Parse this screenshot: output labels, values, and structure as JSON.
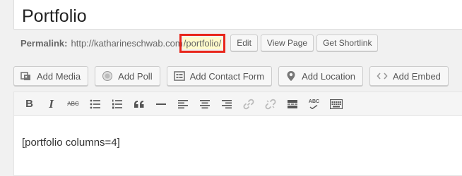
{
  "post": {
    "title": "Portfolio"
  },
  "permalink": {
    "label": "Permalink:",
    "host": "http://katharineschwab.com",
    "slash_before": "/",
    "slug": "portfolio",
    "slash_after": "/",
    "edit_label": "Edit",
    "view_label": "View Page",
    "shortlink_label": "Get Shortlink"
  },
  "media_buttons": {
    "add_media": "Add Media",
    "add_poll": "Add Poll",
    "add_contact_form": "Add Contact Form",
    "add_location": "Add Location",
    "add_embed": "Add Embed"
  },
  "toolbar": {
    "bold": "B",
    "italic": "I",
    "strike": "ABC",
    "spellcheck": "ABC"
  },
  "editor": {
    "content": "[portfolio columns=4]"
  },
  "colors": {
    "highlight_box": "#e8261b",
    "slug_background": "#fffbcc"
  }
}
